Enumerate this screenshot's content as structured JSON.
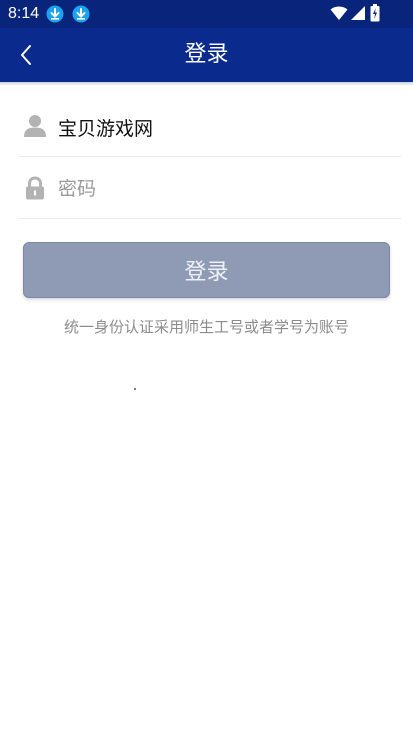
{
  "status_bar": {
    "time": "8:14",
    "background": "#08247b",
    "icons": [
      "download-icon",
      "download-icon",
      "wifi-icon",
      "signal-icon",
      "battery-icon"
    ]
  },
  "app_bar": {
    "title": "登录",
    "background": "#0a2a8e",
    "back_icon": "chevron-left-icon"
  },
  "form": {
    "username": {
      "icon": "user-icon",
      "value": "宝贝游戏网",
      "placeholder": ""
    },
    "password": {
      "icon": "lock-icon",
      "value": "",
      "placeholder": "密码"
    },
    "login_button": {
      "label": "登录",
      "background": "#8f9bb4"
    },
    "hint": "统一身份认证采用师生工号或者学号为账号"
  }
}
